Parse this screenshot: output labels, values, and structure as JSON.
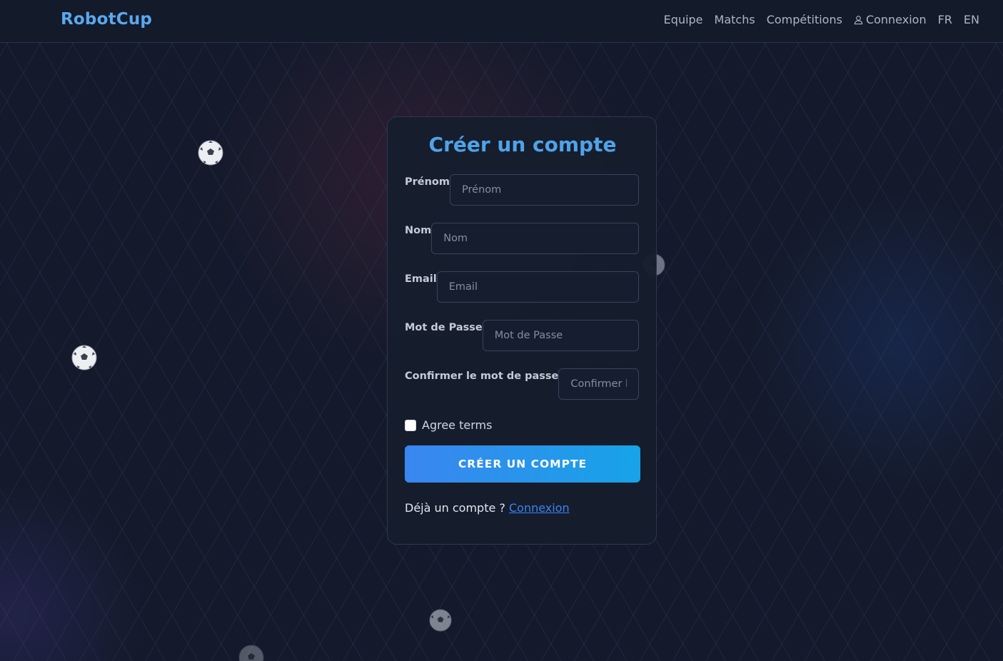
{
  "navbar": {
    "brand": "RobotCup",
    "links": [
      "Equipe",
      "Matchs",
      "Compétitions"
    ],
    "login_label": "Connexion",
    "lang_fr": "FR",
    "lang_en": "EN"
  },
  "form": {
    "title": "Créer un compte",
    "fields": [
      {
        "label": "Prénom",
        "placeholder": "Prénom"
      },
      {
        "label": "Nom",
        "placeholder": "Nom"
      },
      {
        "label": "Email",
        "placeholder": "Email"
      },
      {
        "label": "Mot de Passe",
        "placeholder": "Mot de Passe"
      },
      {
        "label": "Confirmer le mot de passe",
        "placeholder": "Confirmer le mot"
      }
    ],
    "terms_label": "Agree terms",
    "submit_label": "CRÉER UN COMPTE",
    "already_text": "Déjà un compte ?",
    "login_link": "Connexion"
  },
  "decorations": {
    "ball_icon": "soccer-ball-icon",
    "accent_color": "#4fa3e8",
    "button_gradient": [
      "#3a86f0",
      "#17a3e7"
    ]
  }
}
